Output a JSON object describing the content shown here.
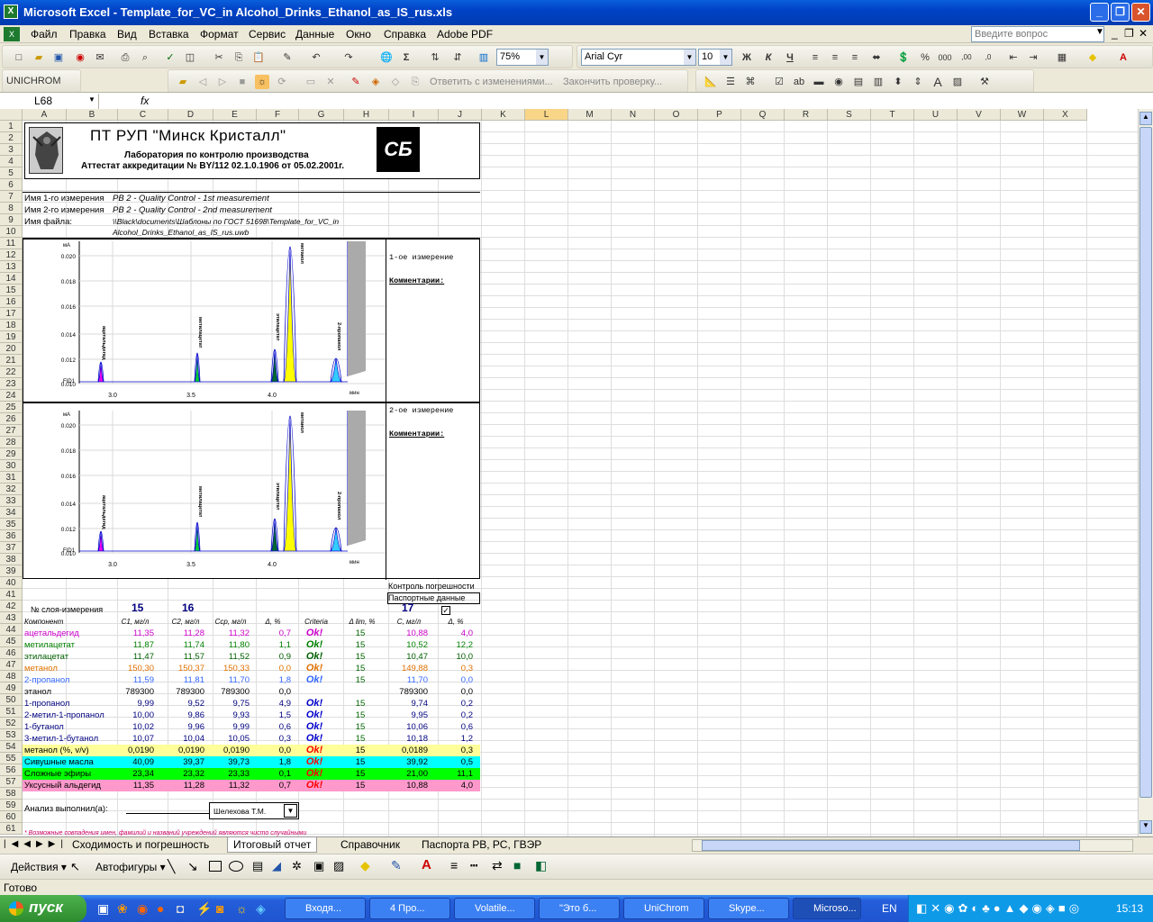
{
  "window": {
    "title": "Microsoft Excel - Template_for_VC_in Alcohol_Drinks_Ethanol_as_IS_rus.xls"
  },
  "menu": [
    "Файл",
    "Правка",
    "Вид",
    "Вставка",
    "Формат",
    "Сервис",
    "Данные",
    "Окно",
    "Справка",
    "Adobe PDF"
  ],
  "help_placeholder": "Введите вопрос",
  "toolbar": {
    "zoom": "75%",
    "font": "Arial Cyr",
    "size": "10",
    "unichrom": "UNICHROM",
    "review_reply": "Ответить с изменениями...",
    "review_end": "Закончить проверку..."
  },
  "formula": {
    "namebox": "L68",
    "fx": "fx"
  },
  "columns": [
    "A",
    "B",
    "C",
    "D",
    "E",
    "F",
    "G",
    "H",
    "I",
    "J",
    "K",
    "L",
    "M",
    "N",
    "O",
    "P",
    "Q",
    "R",
    "S",
    "T",
    "U",
    "V",
    "W",
    "X"
  ],
  "header": {
    "company": "ПТ РУП \"Минск Кристалл\"",
    "lab": "Лаборатория по контролю производства",
    "attest": "Аттестат аккредитации № BY/112 02.1.0.1906 от 05.02.2001г.",
    "logo_text": "СБ"
  },
  "meta": {
    "m1_label": "Имя 1-го измерения",
    "m1_value": "PB 2 - Quality Control - 1st measurement",
    "m2_label": "Имя 2-го измерения",
    "m2_value": "PB 2 - Quality Control - 2nd measurement",
    "file_label": "Имя файла:",
    "file_value1": "\\\\Black\\documents\\Шаблоны по ГОСТ 51698\\Template_for_VC_in",
    "file_value2": "Alcohol_Drinks_Ethanol_as_IS_rus.uwb"
  },
  "chrom1": {
    "side": "1-ое измерение",
    "comments": "Комментарии:"
  },
  "chrom2": {
    "side": "2-ое измерение",
    "comments": "Комментарии:"
  },
  "chart_axis": {
    "y_unit": "мА",
    "y_ticks": [
      "0.020",
      "0.018",
      "0.016",
      "0.014",
      "0.012",
      "0.010"
    ],
    "x_ticks": [
      "3.0",
      "3.5",
      "4.0"
    ],
    "x_unit": "мин",
    "detector": "FID1",
    "peak_labels": [
      "ацетальдегид",
      "метилацетат",
      "этилацетат",
      "метанол",
      "2-пропанол"
    ]
  },
  "control": {
    "label1": "Контроль погрешности",
    "label2": "Паспортные данные",
    "layer_label": "№ слоя-измерения",
    "l1": "15",
    "l2": "16",
    "l3": "17"
  },
  "table_header": [
    "Компонент",
    "C1, мг/л",
    "C2, мг/л",
    "Сср, мг/л",
    "Δ, %",
    "Criteria",
    "Δ lim, %",
    "C, мг/л",
    "Δ, %"
  ],
  "rows": [
    {
      "name": "ацетальдегид",
      "c1": "11,35",
      "c2": "11,28",
      "cs": "11,32",
      "d": "0,7",
      "ok": "Ok!",
      "lim": "15",
      "c": "10,88",
      "d2": "4,0",
      "color": "#cc00cc",
      "okcolor": "#cc00cc",
      "bg": ""
    },
    {
      "name": "метилацетат",
      "c1": "11,87",
      "c2": "11,74",
      "cs": "11,80",
      "d": "1,1",
      "ok": "Ok!",
      "lim": "15",
      "c": "10,52",
      "d2": "12,2",
      "color": "#008000",
      "okcolor": "#008000",
      "bg": ""
    },
    {
      "name": "этилацетат",
      "c1": "11,47",
      "c2": "11,57",
      "cs": "11,52",
      "d": "0,9",
      "ok": "Ok!",
      "lim": "15",
      "c": "10,47",
      "d2": "10,0",
      "color": "#006000",
      "okcolor": "#006000",
      "bg": ""
    },
    {
      "name": "метанол",
      "c1": "150,30",
      "c2": "150,37",
      "cs": "150,33",
      "d": "0,0",
      "ok": "Ok!",
      "lim": "15",
      "c": "149,88",
      "d2": "0,3",
      "color": "#e07000",
      "okcolor": "#e07000",
      "bg": ""
    },
    {
      "name": "2-пропанол",
      "c1": "11,59",
      "c2": "11,81",
      "cs": "11,70",
      "d": "1,8",
      "ok": "Ok!",
      "lim": "15",
      "c": "11,70",
      "d2": "0,0",
      "color": "#3366ff",
      "okcolor": "#3366ff",
      "bg": ""
    },
    {
      "name": "этанол",
      "c1": "789300",
      "c2": "789300",
      "cs": "789300",
      "d": "0,0",
      "ok": "",
      "lim": "",
      "c": "789300",
      "d2": "0,0",
      "color": "#000000",
      "okcolor": "#000",
      "bg": ""
    },
    {
      "name": "1-пропанол",
      "c1": "9,99",
      "c2": "9,52",
      "cs": "9,75",
      "d": "4,9",
      "ok": "Ok!",
      "lim": "15",
      "c": "9,74",
      "d2": "0,2",
      "color": "#000080",
      "okcolor": "#0000cc",
      "bg": ""
    },
    {
      "name": "2-метил-1-пропанол",
      "c1": "10,00",
      "c2": "9,86",
      "cs": "9,93",
      "d": "1,5",
      "ok": "Ok!",
      "lim": "15",
      "c": "9,95",
      "d2": "0,2",
      "color": "#000080",
      "okcolor": "#0000cc",
      "bg": ""
    },
    {
      "name": "1-бутанол",
      "c1": "10,02",
      "c2": "9,96",
      "cs": "9,99",
      "d": "0,6",
      "ok": "Ok!",
      "lim": "15",
      "c": "10,06",
      "d2": "0,6",
      "color": "#000080",
      "okcolor": "#0000cc",
      "bg": ""
    },
    {
      "name": "3-метил-1-бутанол",
      "c1": "10,07",
      "c2": "10,04",
      "cs": "10,05",
      "d": "0,3",
      "ok": "Ok!",
      "lim": "15",
      "c": "10,18",
      "d2": "1,2",
      "color": "#000080",
      "okcolor": "#0000cc",
      "bg": ""
    },
    {
      "name": "метанол (%, v/v)",
      "c1": "0,0190",
      "c2": "0,0190",
      "cs": "0,0190",
      "d": "0,0",
      "ok": "Ok!",
      "lim": "15",
      "c": "0,0189",
      "d2": "0,3",
      "color": "#000000",
      "okcolor": "#ff0000",
      "bg": "#ffff99"
    },
    {
      "name": "Сивушные масла",
      "c1": "40,09",
      "c2": "39,37",
      "cs": "39,73",
      "d": "1,8",
      "ok": "Ok!",
      "lim": "15",
      "c": "39,92",
      "d2": "0,5",
      "color": "#000000",
      "okcolor": "#ff0000",
      "bg": "#00ffff"
    },
    {
      "name": "Сложные эфиры",
      "c1": "23,34",
      "c2": "23,32",
      "cs": "23,33",
      "d": "0,1",
      "ok": "Ok!",
      "lim": "15",
      "c": "21,00",
      "d2": "11,1",
      "color": "#000000",
      "okcolor": "#ff0000",
      "bg": "#00ff00"
    },
    {
      "name": "Уксусный альдегид",
      "c1": "11,35",
      "c2": "11,28",
      "cs": "11,32",
      "d": "0,7",
      "ok": "Ok!",
      "lim": "15",
      "c": "10,88",
      "d2": "4,0",
      "color": "#000000",
      "okcolor": "#ff0000",
      "bg": "#ff99cc"
    }
  ],
  "analysis": {
    "label": "Анализ выполнил(а):",
    "person": "Шелехова Т.М.",
    "footnote": "* Возможные совпадения имен, фамилий и названий учреждений являются чисто случайными"
  },
  "tabs": [
    "Сходимость и погрешность",
    "Итоговый отчет",
    "Справочник",
    "Паспорта РВ, РС, ГВЭР"
  ],
  "drawbar": {
    "actions": "Действия",
    "autoshapes": "Автофигуры"
  },
  "status": "Готово",
  "taskbar": {
    "start": "пуск",
    "tasks": [
      "Входя...",
      "4 Про...",
      "Volatile...",
      "\"Это б...",
      "UniChrom",
      "Skype...",
      "Microso..."
    ],
    "lang": "EN",
    "clock": "15:13"
  }
}
